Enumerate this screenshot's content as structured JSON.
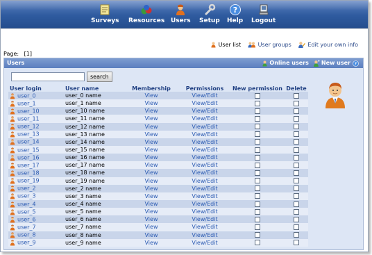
{
  "menu": [
    {
      "label": "Surveys",
      "icon": "surveys-icon"
    },
    {
      "label": "Resources",
      "icon": "resources-icon"
    },
    {
      "label": "Users",
      "icon": "users-icon"
    },
    {
      "label": "Setup",
      "icon": "setup-icon"
    },
    {
      "label": "Help",
      "icon": "help-icon"
    },
    {
      "label": "Logout",
      "icon": "logout-icon"
    }
  ],
  "toplinks": {
    "user_list": "User list",
    "user_groups": "User groups",
    "edit_info": "Edit your own info"
  },
  "page": {
    "label": "Page:",
    "value": "[1]"
  },
  "panel": {
    "title": "Users",
    "online_users": "Online users",
    "new_user": "New user"
  },
  "search": {
    "value": "",
    "button": "search"
  },
  "columns": {
    "login": "User login",
    "name": "User name",
    "membership": "Membership",
    "permissions": "Permissions",
    "new_permission": "New permission",
    "delete": "Delete"
  },
  "rows": [
    {
      "login": "user_0",
      "name": "user_0 name",
      "membership": "View",
      "permissions": "View/Edit"
    },
    {
      "login": "user_1",
      "name": "user_1 name",
      "membership": "View",
      "permissions": "View/Edit"
    },
    {
      "login": "user_10",
      "name": "user_10 name",
      "membership": "View",
      "permissions": "View/Edit"
    },
    {
      "login": "user_11",
      "name": "user_11 name",
      "membership": "View",
      "permissions": "View/Edit"
    },
    {
      "login": "user_12",
      "name": "user_12 name",
      "membership": "View",
      "permissions": "View/Edit"
    },
    {
      "login": "user_13",
      "name": "user_13 name",
      "membership": "View",
      "permissions": "View/Edit"
    },
    {
      "login": "user_14",
      "name": "user_14 name",
      "membership": "View",
      "permissions": "View/Edit"
    },
    {
      "login": "user_15",
      "name": "user_15 name",
      "membership": "View",
      "permissions": "View/Edit"
    },
    {
      "login": "user_16",
      "name": "user_16 name",
      "membership": "View",
      "permissions": "View/Edit"
    },
    {
      "login": "user_17",
      "name": "user_17 name",
      "membership": "View",
      "permissions": "View/Edit"
    },
    {
      "login": "user_18",
      "name": "user_18 name",
      "membership": "View",
      "permissions": "View/Edit"
    },
    {
      "login": "user_19",
      "name": "user_19 name",
      "membership": "View",
      "permissions": "View/Edit"
    },
    {
      "login": "user_2",
      "name": "user_2 name",
      "membership": "View",
      "permissions": "View/Edit"
    },
    {
      "login": "user_3",
      "name": "user_3 name",
      "membership": "View",
      "permissions": "View/Edit"
    },
    {
      "login": "user_4",
      "name": "user_4 name",
      "membership": "View",
      "permissions": "View/Edit"
    },
    {
      "login": "user_5",
      "name": "user_5 name",
      "membership": "View",
      "permissions": "View/Edit"
    },
    {
      "login": "user_6",
      "name": "user_6 name",
      "membership": "View",
      "permissions": "View/Edit"
    },
    {
      "login": "user_7",
      "name": "user_7 name",
      "membership": "View",
      "permissions": "View/Edit"
    },
    {
      "login": "user_8",
      "name": "user_8 name",
      "membership": "View",
      "permissions": "View/Edit"
    },
    {
      "login": "user_9",
      "name": "user_9 name",
      "membership": "View",
      "permissions": "View/Edit"
    }
  ],
  "colors": {
    "topbar": "#2f5b9f",
    "panel_bg": "#dde6f5",
    "row_odd": "#c9d5ea",
    "row_even": "#e6ecf7",
    "link": "#2d5cb3"
  }
}
